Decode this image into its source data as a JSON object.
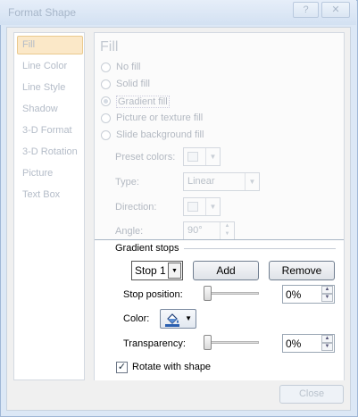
{
  "window": {
    "title": "Format Shape",
    "help_label": "?",
    "close_label": "✕"
  },
  "sidebar": {
    "items": [
      {
        "label": "Fill",
        "selected": true
      },
      {
        "label": "Line Color"
      },
      {
        "label": "Line Style"
      },
      {
        "label": "Shadow"
      },
      {
        "label": "3-D Format"
      },
      {
        "label": "3-D Rotation"
      },
      {
        "label": "Picture"
      },
      {
        "label": "Text Box"
      }
    ]
  },
  "fill": {
    "heading": "Fill",
    "options": [
      {
        "label": "No fill",
        "selected": false
      },
      {
        "label": "Solid fill",
        "selected": false
      },
      {
        "label": "Gradient fill",
        "selected": true
      },
      {
        "label": "Picture or texture fill",
        "selected": false
      },
      {
        "label": "Slide background fill",
        "selected": false
      }
    ],
    "preset_colors_label": "Preset colors:",
    "type_label": "Type:",
    "type_value": "Linear",
    "direction_label": "Direction:",
    "angle_label": "Angle:",
    "angle_value": "90°"
  },
  "gradient_stops": {
    "title": "Gradient stops",
    "stop_value": "Stop 1",
    "add_label": "Add",
    "remove_label": "Remove",
    "stop_position_label": "Stop position:",
    "stop_position_value": "0%",
    "color_label": "Color:",
    "transparency_label": "Transparency:",
    "transparency_value": "0%",
    "rotate_label": "Rotate with shape",
    "rotate_checked": true
  },
  "footer": {
    "close_label": "Close"
  }
}
